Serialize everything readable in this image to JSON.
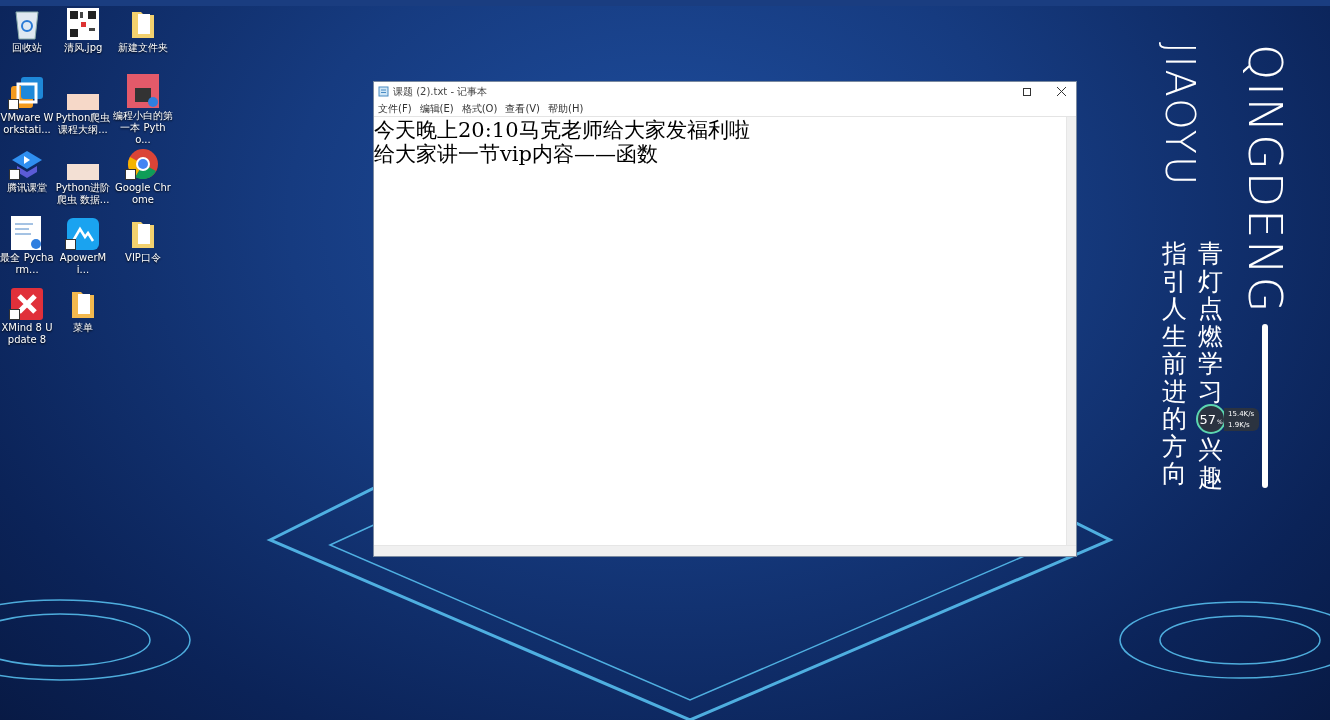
{
  "desktop_icons": [
    {
      "label": "回收站",
      "shortcut": false
    },
    {
      "label": "清风.jpg",
      "shortcut": false
    },
    {
      "label": "新建文件夹",
      "shortcut": false
    },
    {
      "label": "VMware Workstati...",
      "shortcut": true
    },
    {
      "label": "Python爬虫课程大纲...",
      "shortcut": false
    },
    {
      "label": "编程小白的第一本 Pytho...",
      "shortcut": false
    },
    {
      "label": "腾讯课堂",
      "shortcut": true
    },
    {
      "label": "Python进阶爬虫 数据...",
      "shortcut": false
    },
    {
      "label": "Google Chrome",
      "shortcut": true
    },
    {
      "label": "最全 Pycharm...",
      "shortcut": false
    },
    {
      "label": "ApowerMi...",
      "shortcut": true
    },
    {
      "label": "VIP口令",
      "shortcut": false
    },
    {
      "label": "XMind 8 Update 8",
      "shortcut": true
    },
    {
      "label": "菜单",
      "shortcut": false
    }
  ],
  "wallpaper": {
    "brand_line_1": "QINGDENG",
    "brand_line_2": "JIAOYU",
    "slogan_1": "青灯点燃学习",
    "slogan_1_end": "兴趣",
    "slogan_2": "指引人生前进的方向"
  },
  "notepad": {
    "title": "课题 (2).txt - 记事本",
    "menu": [
      "文件(F)",
      "编辑(E)",
      "格式(O)",
      "查看(V)",
      "帮助(H)"
    ],
    "lines": [
      "今天晚上20:10马克老师给大家发福利啦",
      "给大家讲一节vip内容——函数"
    ]
  },
  "network_widget": {
    "percent": "57",
    "unit": "%",
    "upload": "15.4K/s",
    "download": "1.9K/s"
  }
}
